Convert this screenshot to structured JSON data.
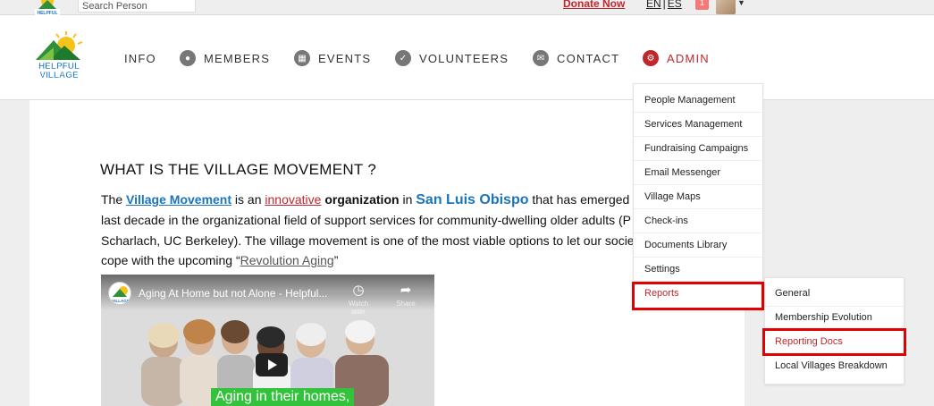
{
  "topbar": {
    "search_placeholder": "Search Person",
    "donate": "Donate Now",
    "lang_en": "EN",
    "lang_es": "ES",
    "notification_count": "1"
  },
  "logo": {
    "line1": "HELPFUL",
    "line2": "VILLAGE"
  },
  "nav": {
    "info": "INFO",
    "members": "MEMBERS",
    "events": "EVENTS",
    "volunteers": "VOLUNTEERS",
    "contact": "CONTACT",
    "admin": "ADMIN"
  },
  "content": {
    "heading": "WHAT IS THE VILLAGE MOVEMENT ?",
    "line1_a": "The ",
    "line1_link": "Village Movement",
    "line1_b": " is an ",
    "line1_red": "innovative",
    "line1_c": " ",
    "line1_bold": "organization",
    "line1_d": " in ",
    "line1_city": "San Luis Obispo",
    "line1_e": " that has emerged",
    "line2": "last decade in the organizational field of support services for community-dwelling older adults (P",
    "line3": "Scharlach, UC Berkeley). The village movement is one of the most viable options to let our socie",
    "line4_a": "cope with the upcoming “",
    "line4_link": "Revolution Aging",
    "line4_b": "”"
  },
  "video": {
    "title": "Aging At Home but not Alone - Helpful...",
    "watch_later": "Watch later",
    "share": "Share",
    "caption": "Aging in their homes,"
  },
  "admin_menu": {
    "items": [
      "People Management",
      "Services Management",
      "Fundraising Campaigns",
      "Email Messenger",
      "Village Maps",
      "Check-ins",
      "Documents Library",
      "Settings",
      "Reports"
    ]
  },
  "reports_submenu": {
    "items": [
      "General",
      "Membership Evolution",
      "Reporting Docs",
      "Local Villages Breakdown"
    ]
  },
  "colors": {
    "accent_red": "#c0272d",
    "link_blue": "#1b75bb",
    "highlight_box": "#e20000",
    "caption_green": "#33c23b"
  }
}
